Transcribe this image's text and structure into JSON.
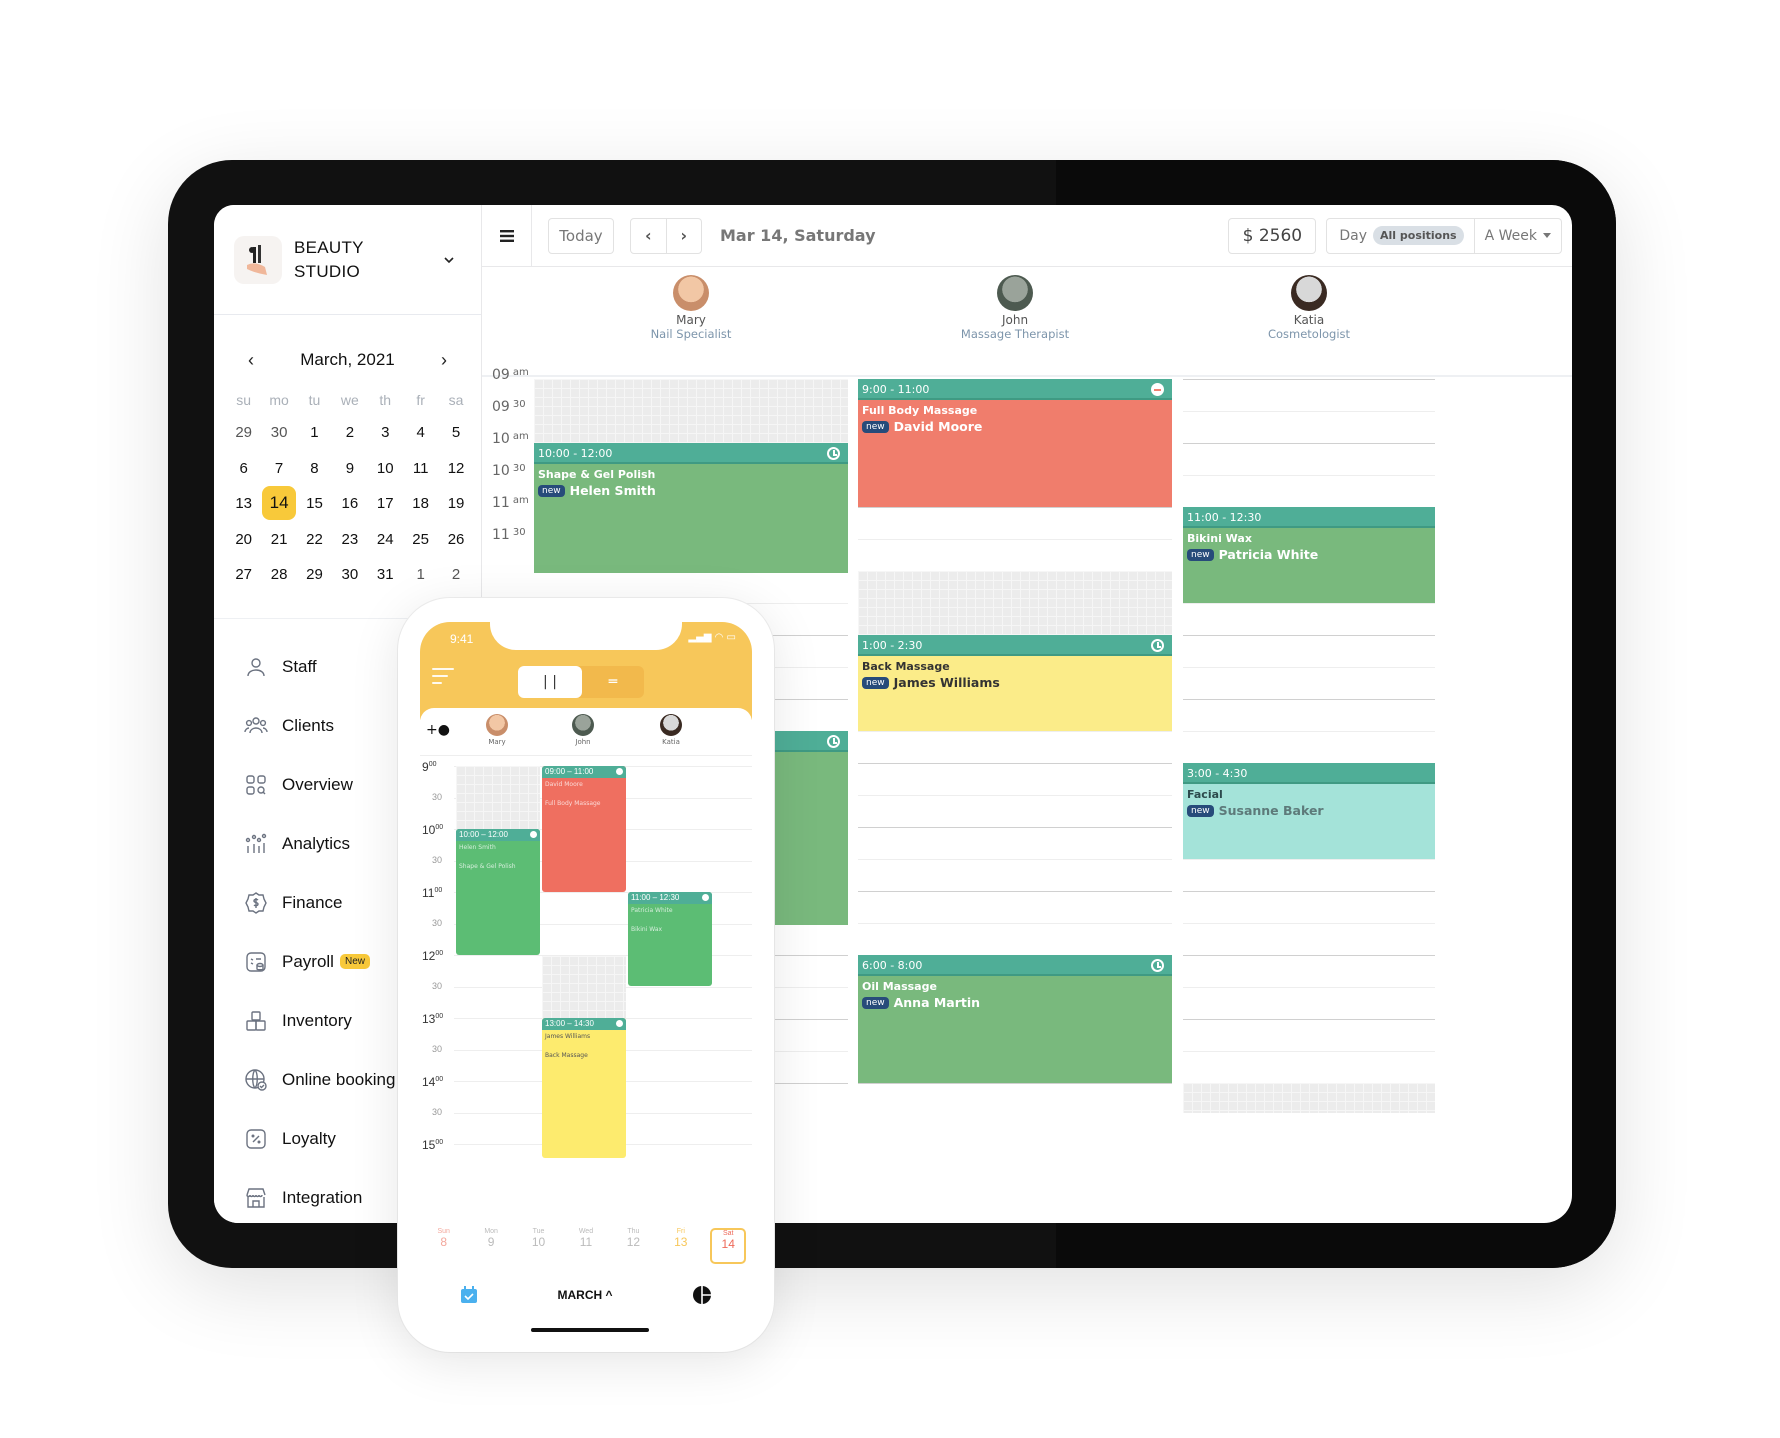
{
  "brand": {
    "name_line1": "BEAUTY",
    "name_line2": "STUDIO"
  },
  "mini_calendar": {
    "title": "March, 2021",
    "prev_label": "‹",
    "next_label": "›",
    "weekdays": [
      "su",
      "mo",
      "tu",
      "we",
      "th",
      "fr",
      "sa"
    ],
    "weeks": [
      [
        "29",
        "30",
        "1",
        "2",
        "3",
        "4",
        "5"
      ],
      [
        "6",
        "7",
        "8",
        "9",
        "10",
        "11",
        "12"
      ],
      [
        "13",
        "14",
        "15",
        "16",
        "17",
        "18",
        "19"
      ],
      [
        "20",
        "21",
        "22",
        "23",
        "24",
        "25",
        "26"
      ],
      [
        "27",
        "28",
        "29",
        "30",
        "31",
        "1",
        "2"
      ]
    ],
    "selected": "14"
  },
  "sidebar": {
    "items": [
      {
        "label": "Staff",
        "icon": "user-icon"
      },
      {
        "label": "Clients",
        "icon": "users-icon"
      },
      {
        "label": "Overview",
        "icon": "grid-search-icon"
      },
      {
        "label": "Analytics",
        "icon": "analytics-icon"
      },
      {
        "label": "Finance",
        "icon": "dollar-badge-icon"
      },
      {
        "label": "Payroll",
        "icon": "payroll-icon",
        "badge": "New"
      },
      {
        "label": "Inventory",
        "icon": "boxes-icon"
      },
      {
        "label": "Online booking",
        "icon": "globe-check-icon"
      },
      {
        "label": "Loyalty",
        "icon": "percent-icon"
      },
      {
        "label": "Integration",
        "icon": "store-icon"
      }
    ]
  },
  "toolbar": {
    "today_label": "Today",
    "prev_label": "‹",
    "next_label": "›",
    "date_title": "Mar 14, Saturday",
    "revenue": "$ 2560",
    "view_day": "Day",
    "positions_filter": "All positions",
    "range_select": "A Week"
  },
  "staff": [
    {
      "name": "Mary",
      "role": "Nail Specialist"
    },
    {
      "name": "John",
      "role": "Massage Therapist"
    },
    {
      "name": "Katia",
      "role": "Cosmetologist"
    }
  ],
  "time_labels": [
    {
      "h": "09",
      "s": "am"
    },
    {
      "h": "09",
      "s": "30"
    },
    {
      "h": "10",
      "s": "am"
    },
    {
      "h": "10",
      "s": "30"
    },
    {
      "h": "11",
      "s": "am"
    },
    {
      "h": "11",
      "s": "30"
    }
  ],
  "appointments": [
    {
      "staff": "Mary",
      "time": "10:00 - 12:00",
      "service": "Shape & Gel Polish",
      "client": "Helen Smith",
      "tag": "new",
      "status": "clock"
    },
    {
      "staff": "Mary",
      "time": "",
      "service": "",
      "client": "",
      "tag": "",
      "status": "clock"
    },
    {
      "staff": "John",
      "time": "9:00 - 11:00",
      "service": "Full Body Massage",
      "client": "David Moore",
      "tag": "new",
      "status": "minus"
    },
    {
      "staff": "John",
      "time": "1:00 - 2:30",
      "service": "Back Massage",
      "client": "James Williams",
      "tag": "new",
      "status": "clock"
    },
    {
      "staff": "John",
      "time": "6:00 - 8:00",
      "service": "Oil Massage",
      "client": "Anna Martin",
      "tag": "new",
      "status": "clock"
    },
    {
      "staff": "Katia",
      "time": "11:00 - 12:30",
      "service": "Bikini Wax",
      "client": "Patricia White",
      "tag": "new",
      "status": ""
    },
    {
      "staff": "Katia",
      "time": "3:00 - 4:30",
      "service": "Facial",
      "client": "Susanne Baker",
      "tag": "new",
      "status": ""
    }
  ],
  "phone": {
    "clock": "9:41",
    "staff": [
      "Mary",
      "John",
      "Katia"
    ],
    "time_labels": [
      {
        "t": "9",
        "s": "00"
      },
      {
        "t": "30",
        "s": ""
      },
      {
        "t": "10",
        "s": "00"
      },
      {
        "t": "30",
        "s": ""
      },
      {
        "t": "11",
        "s": "00"
      },
      {
        "t": "30",
        "s": ""
      },
      {
        "t": "12",
        "s": "00"
      },
      {
        "t": "30",
        "s": ""
      },
      {
        "t": "13",
        "s": "00"
      },
      {
        "t": "30",
        "s": ""
      },
      {
        "t": "14",
        "s": "00"
      },
      {
        "t": "30",
        "s": ""
      },
      {
        "t": "15",
        "s": "00"
      }
    ],
    "appointments": [
      {
        "time": "10:00 – 12:00",
        "client": "Helen Smith",
        "service": "Shape & Gel Polish"
      },
      {
        "time": "09:00 – 11:00",
        "client": "David Moore",
        "service": "Full Body Massage"
      },
      {
        "time": "11:00 – 12:30",
        "client": "Patricia White",
        "service": "Bikini Wax"
      },
      {
        "time": "13:00 – 14:30",
        "client": "James Williams",
        "service": "Back Massage"
      }
    ],
    "days": [
      {
        "w": "Sun",
        "n": "8"
      },
      {
        "w": "Mon",
        "n": "9"
      },
      {
        "w": "Tue",
        "n": "10"
      },
      {
        "w": "Wed",
        "n": "11"
      },
      {
        "w": "Thu",
        "n": "12"
      },
      {
        "w": "Fri",
        "n": "13"
      },
      {
        "w": "Sat",
        "n": "14"
      }
    ],
    "month_label": "MARCH ^"
  },
  "colors": {
    "accent_yellow": "#f8c93a",
    "header_teal": "#4fae97",
    "green": "#79b97d",
    "red": "#f07d6c",
    "yellow": "#fbec89",
    "teal": "#a4e3d9",
    "new_tag": "#274b7a"
  }
}
